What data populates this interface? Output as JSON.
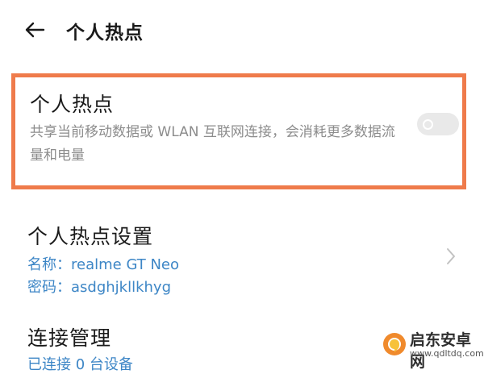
{
  "header": {
    "back_icon": "arrow-left-icon",
    "title": "个人热点"
  },
  "hotspot": {
    "title": "个人热点",
    "description": "共享当前移动数据或 WLAN 互联网连接，会消耗更多数据流量和电量",
    "toggle_on": false,
    "highlight_color": "#ef7b4b"
  },
  "hotspot_settings": {
    "title": "个人热点设置",
    "name_line": "名称：realme GT Neo",
    "password_line": "密码：asdghjkllkhyg",
    "chevron_icon": "chevron-right-icon"
  },
  "connection_management": {
    "title": "连接管理",
    "subtitle": "已连接 0 台设备"
  },
  "watermark": {
    "name": "启东安卓网",
    "url": "www.qdltdq.com"
  },
  "colors": {
    "link_blue": "#3d86c6",
    "secondary_text": "#8c8c8c",
    "toggle_off": "#e9e9e9"
  }
}
